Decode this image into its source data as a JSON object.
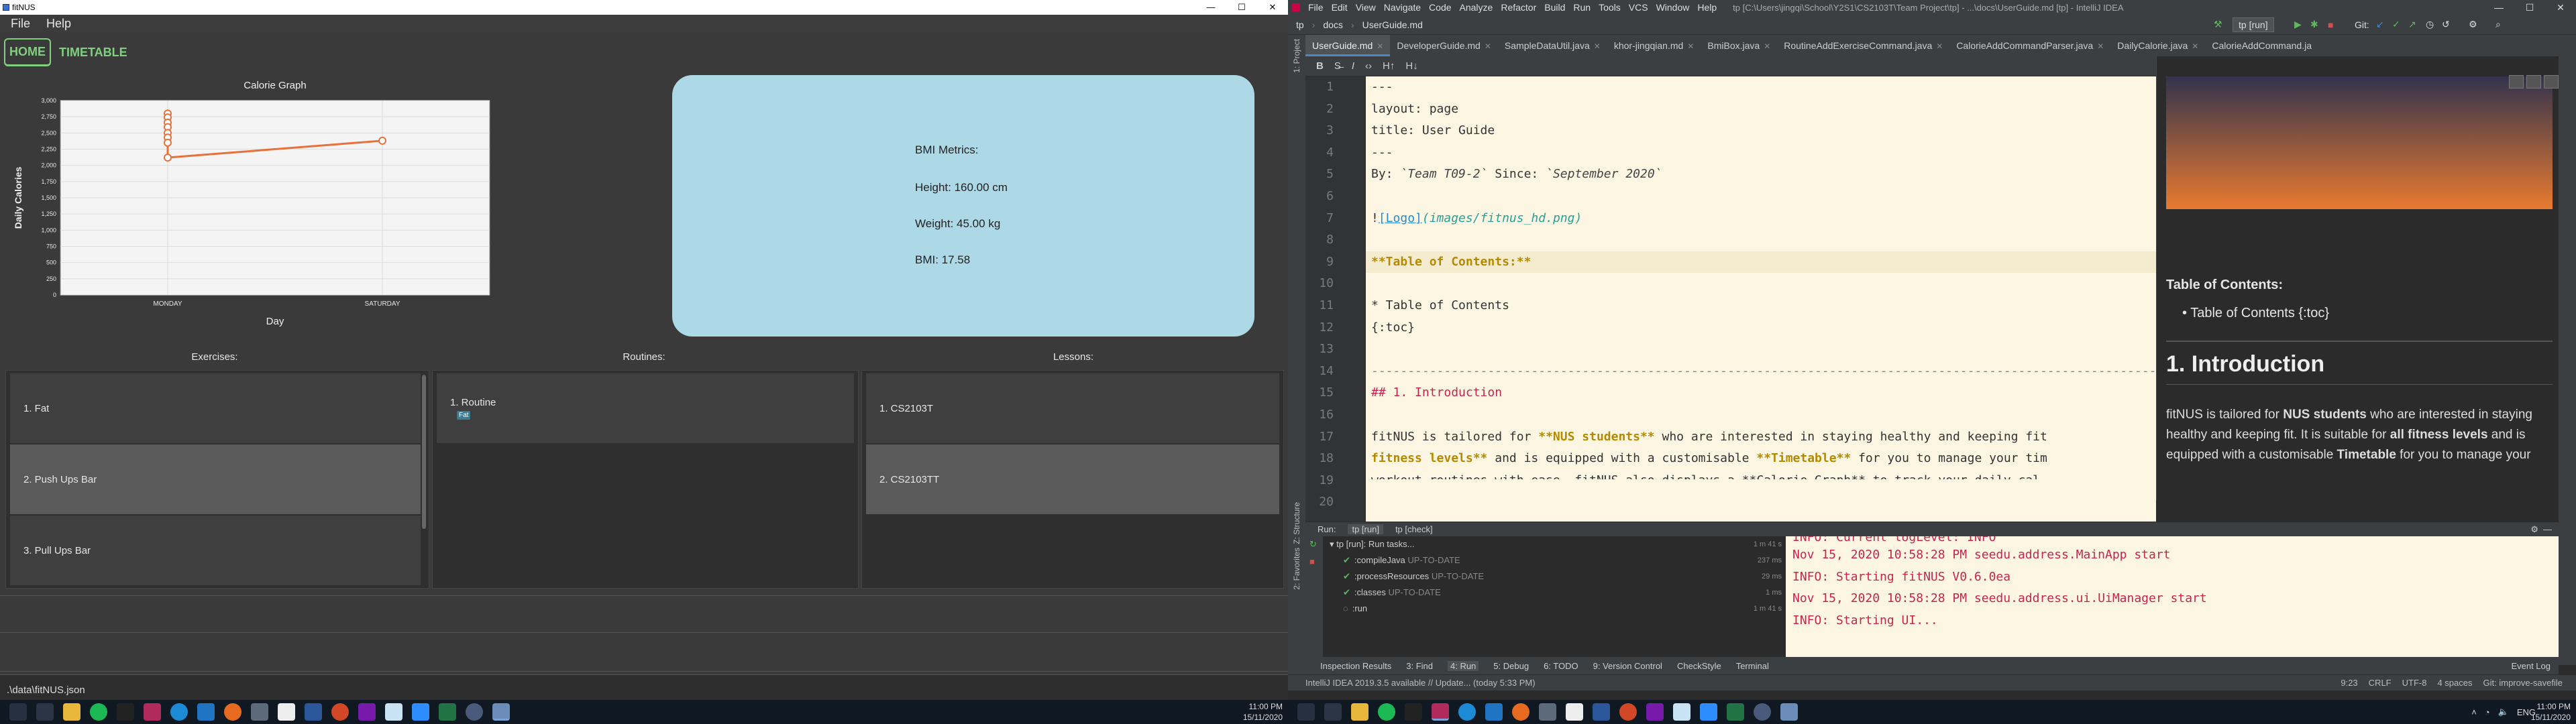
{
  "fitnus": {
    "window_title": "fitNUS",
    "window_controls": [
      "—",
      "☐",
      "✕"
    ],
    "menu": [
      "File",
      "Help"
    ],
    "tabs": [
      {
        "label": "HOME",
        "selected": true
      },
      {
        "label": "TIMETABLE",
        "selected": false
      }
    ],
    "bmi": {
      "title": "BMI Metrics:",
      "height": "Height: 160.00 cm",
      "weight": "Weight: 45.00 kg",
      "bmi": "BMI: 17.58"
    },
    "exercises_header": "Exercises:",
    "routines_header": "Routines:",
    "lessons_header": "Lessons:",
    "exercises": [
      "1.  Fat",
      "2.  Push Ups Bar",
      "3.  Pull Ups Bar"
    ],
    "routines": [
      {
        "label": "1.  Routine",
        "tag": "Fat"
      }
    ],
    "lessons": [
      "1.  CS2103T",
      "2.  CS2103TT"
    ],
    "status_path": ".\\data\\fitNUS.json"
  },
  "chart_data": {
    "type": "line",
    "title": "Calorie Graph",
    "xlabel": "Day",
    "ylabel": "Daily Calories",
    "categories": [
      "MONDAY",
      "SATURDAY"
    ],
    "x": [
      "MONDAY",
      "MONDAY",
      "MONDAY",
      "MONDAY",
      "MONDAY",
      "MONDAY",
      "MONDAY",
      "MONDAY",
      "SATURDAY"
    ],
    "y": [
      2800,
      2740,
      2660,
      2590,
      2500,
      2430,
      2350,
      2120,
      2380
    ],
    "ylim": [
      0,
      3000
    ],
    "yticks": [
      0,
      250,
      500,
      750,
      1000,
      1250,
      1500,
      1750,
      2000,
      2250,
      2500,
      2750,
      3000
    ],
    "color": "#e8703a",
    "grid": true
  },
  "intellij": {
    "menu": [
      "File",
      "Edit",
      "View",
      "Navigate",
      "Code",
      "Analyze",
      "Refactor",
      "Build",
      "Run",
      "Tools",
      "VCS",
      "Window",
      "Help"
    ],
    "path": "tp [C:\\Users\\jingqi\\School\\Y2S1\\CS2103T\\Team Project\\tp] - ...\\docs\\UserGuide.md [tp] - IntelliJ IDEA",
    "breadcrumbs": [
      "tp",
      "docs",
      "UserGuide.md"
    ],
    "run_config": "tp [run]",
    "git_label": "Git:",
    "editor_tabs": [
      "UserGuide.md",
      "DeveloperGuide.md",
      "SampleDataUtil.java",
      "khor-jingqian.md",
      "BmiBox.java",
      "RoutineAddExerciseCommand.java",
      "CalorieAddCommandParser.java",
      "DailyCalorie.java",
      "CalorieAddCommand.ja"
    ],
    "side_tabs": [
      "1: Project",
      "Z: Structure",
      "2: Favorites"
    ],
    "line_numbers": [
      "1",
      "2",
      "3",
      "4",
      "5",
      "6",
      "7",
      "8",
      "9",
      "10",
      "11",
      "12",
      "13",
      "14",
      "15",
      "16",
      "17",
      "18",
      "19",
      "20"
    ],
    "code_lines": [
      "---",
      "layout: page",
      "title: User Guide",
      "---",
      "",
      "",
      "",
      "",
      "",
      "",
      "* Table of Contents",
      "{:toc}",
      "",
      "--------------------------------------------------------------------------------------------------------------------",
      "",
      "",
      "",
      "",
      "",
      ""
    ],
    "code_by": "By: ",
    "code_team": "`Team T09-2`",
    "code_since": " Since: ",
    "code_date": "`September 2020`",
    "code_logo_bang": "!",
    "code_logo_text": "[Logo]",
    "code_logo_path": "(images/fitnus_hd.png)",
    "code_toc_title": "**Table of Contents:**",
    "code_intro": "## 1. Introduction",
    "code_l17_a": "fitNUS is tailored for ",
    "code_l17_b": "**NUS students**",
    "code_l17_c": " who are interested in staying healthy and keeping fit",
    "code_l18_a": "fitness levels**",
    "code_l18_b": " and is equipped with a customisable ",
    "code_l18_c": "**Timetable**",
    "code_l18_d": " for you to manage your tim",
    "code_l19": "workout routines with ease. fitNUS also displays a **Calorie Graph** to track your daily cal",
    "preview": {
      "toc_title": "Table of Contents:",
      "toc_item": "Table of Contents {:toc}",
      "h1": "1. Introduction",
      "para_a": "fitNUS is tailored for ",
      "para_b": "NUS students",
      "para_c": " who are interested in staying healthy and keeping fit. It is suitable for ",
      "para_d": "all fitness levels",
      "para_e": " and is equipped with a customisable ",
      "para_f": "Timetable",
      "para_g": " for you to manage your"
    },
    "run_tabs": [
      "Run:",
      "tp [run]",
      "tp [check]"
    ],
    "run_tree": [
      {
        "label": "tp [run]: Run tasks...",
        "time": "1 m 41 s",
        "level": 0
      },
      {
        "label": ":compileJava",
        "status": "UP-TO-DATE",
        "time": "237 ms",
        "level": 1
      },
      {
        "label": ":processResources",
        "status": "UP-TO-DATE",
        "time": "29 ms",
        "level": 1
      },
      {
        "label": ":classes",
        "status": "UP-TO-DATE",
        "time": "1 ms",
        "level": 1
      },
      {
        "label": ":run",
        "status": "",
        "time": "1 m 41 s",
        "level": 1
      }
    ],
    "console": [
      "INFO: Current logLevel: INFO",
      "Nov 15, 2020 10:58:28 PM seedu.address.MainApp start",
      "INFO: Starting fitNUS V0.6.0ea",
      "Nov 15, 2020 10:58:28 PM seedu.address.ui.UiManager start",
      "INFO: Starting UI..."
    ],
    "bottom_tabs": [
      "Inspection Results",
      "3: Find",
      "4: Run",
      "5: Debug",
      "6: TODO",
      "9: Version Control",
      "CheckStyle",
      "Terminal",
      "Event Log"
    ],
    "status_left": "IntelliJ IDEA 2019.3.5 available // Update... (today 5:33 PM)",
    "status_right": [
      "9:23",
      "CRLF",
      "UTF-8",
      "4 spaces",
      "Git: improve-savefile"
    ]
  },
  "taskbar": {
    "time": "11:00 PM",
    "date": "15/11/2020",
    "lang": "ENG"
  }
}
